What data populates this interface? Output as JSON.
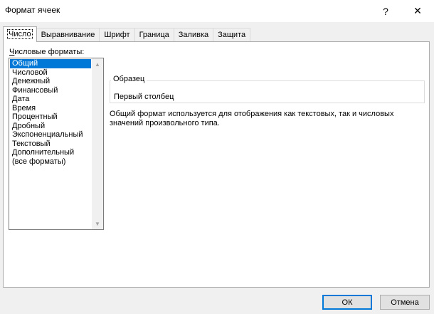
{
  "window": {
    "title": "Формат ячеек",
    "help_glyph": "?",
    "close_glyph": "✕"
  },
  "tabs": [
    {
      "label": "Число",
      "active": true
    },
    {
      "label": "Выравнивание",
      "active": false
    },
    {
      "label": "Шрифт",
      "active": false
    },
    {
      "label": "Граница",
      "active": false
    },
    {
      "label": "Заливка",
      "active": false
    },
    {
      "label": "Защита",
      "active": false
    }
  ],
  "number_formats": {
    "label_mnemonic": "Ч",
    "label_rest": "исловые форматы:",
    "selected_index": 0,
    "items": [
      "Общий",
      "Числовой",
      "Денежный",
      "Финансовый",
      "Дата",
      "Время",
      "Процентный",
      "Дробный",
      "Экспоненциальный",
      "Текстовый",
      "Дополнительный",
      "(все форматы)"
    ]
  },
  "sample": {
    "legend": "Образец",
    "value": "Первый столбец"
  },
  "description": "Общий формат используется для отображения как текстовых, так и числовых значений произвольного типа.",
  "buttons": {
    "ok": "ОК",
    "cancel": "Отмена"
  },
  "colors": {
    "selection": "#0078d7",
    "dialog_bg": "#f0f0f0"
  }
}
